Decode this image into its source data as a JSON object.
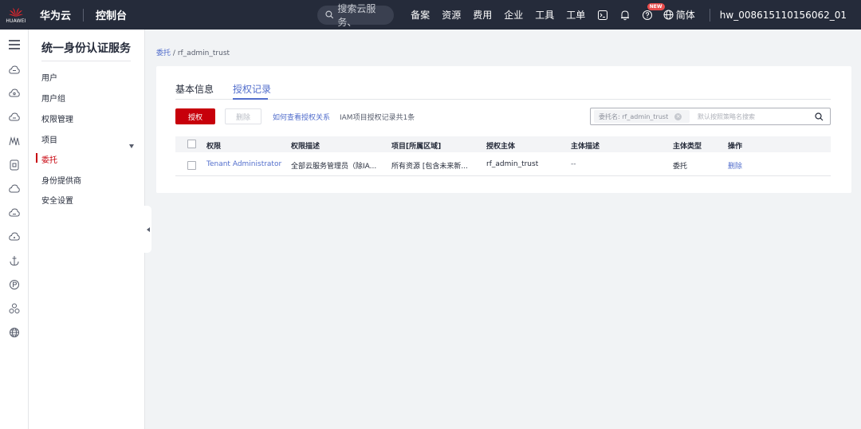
{
  "topbar": {
    "logo_text": "HUAWEI",
    "brand": "华为云",
    "console": "控制台",
    "search_placeholder": "搜索云服务、",
    "nav": [
      "备案",
      "资源",
      "费用",
      "企业",
      "工具",
      "工单"
    ],
    "new_badge": "NEW",
    "language": "简体",
    "user": "hw_008615110156062_01"
  },
  "rail_icons": [
    "menu-icon",
    "cloud-icon",
    "cloud-icon",
    "cloud-icon",
    "ma-icon",
    "document-icon",
    "cloud-icon",
    "cloud-icon",
    "cloud-icon",
    "anchor-icon",
    "p-badge-icon",
    "network-icon",
    "globe-icon"
  ],
  "service_nav": {
    "title": "统一身份认证服务",
    "items": [
      {
        "label": "用户"
      },
      {
        "label": "用户组"
      },
      {
        "label": "权限管理"
      },
      {
        "label": "项目"
      },
      {
        "label": "委托"
      },
      {
        "label": "身份提供商"
      },
      {
        "label": "安全设置"
      }
    ],
    "active_index": 4
  },
  "breadcrumb": {
    "parent": "委托",
    "separator": "/",
    "current": "rf_admin_trust"
  },
  "tabs": [
    {
      "label": "基本信息"
    },
    {
      "label": "授权记录"
    }
  ],
  "active_tab": 1,
  "toolbar": {
    "authorize_label": "授权",
    "delete_label": "删除",
    "help_link": "如何查看授权关系",
    "count_text": "IAM项目授权记录共1条"
  },
  "filter": {
    "chip_label": "委托名: rf_admin_trust",
    "chip_clear": "×",
    "placeholder": "默认按照策略名搜索"
  },
  "table": {
    "headers": [
      "权限",
      "权限描述",
      "项目[所属区域]",
      "授权主体",
      "主体描述",
      "主体类型",
      "操作"
    ],
    "rows": [
      {
        "permission": "Tenant Administrator",
        "description": "全部云服务管理员（除IA...",
        "project": "所有资源 [包含未来新...",
        "principal": "rf_admin_trust",
        "principal_desc": "--",
        "principal_type": "委托",
        "action": "删除"
      }
    ]
  },
  "colors": {
    "topbar_bg": "#252b3a",
    "accent_red": "#c7000b",
    "link_blue": "#526ecc"
  }
}
